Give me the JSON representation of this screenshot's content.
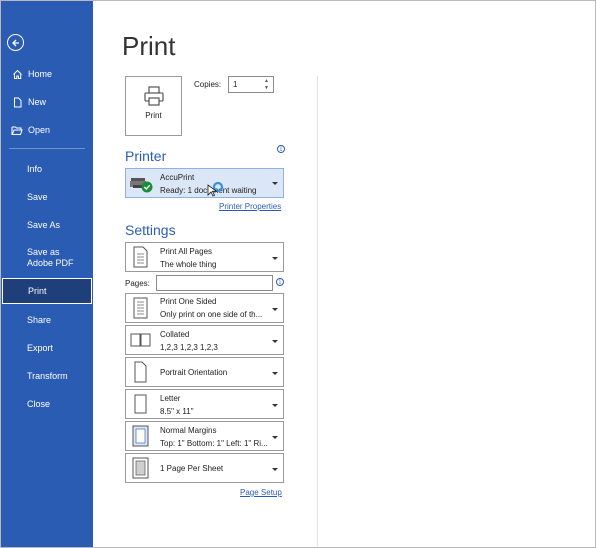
{
  "sidebar": {
    "back_label": "",
    "items": [
      {
        "label": "Home",
        "icon": "home-icon"
      },
      {
        "label": "New",
        "icon": "new-document-icon"
      },
      {
        "label": "Open",
        "icon": "folder-open-icon"
      },
      {
        "label": "Info"
      },
      {
        "label": "Save"
      },
      {
        "label": "Save As"
      },
      {
        "label": "Save as Adobe PDF"
      },
      {
        "label": "Print",
        "active": true
      },
      {
        "label": "Share"
      },
      {
        "label": "Export"
      },
      {
        "label": "Transform"
      },
      {
        "label": "Close"
      }
    ]
  },
  "page": {
    "title": "Print",
    "print_button_label": "Print",
    "copies_label": "Copies:",
    "copies_value": "1"
  },
  "printer": {
    "section_title": "Printer",
    "name": "AccuPrint",
    "status": "Ready: 1 document waiting",
    "properties_link": "Printer Properties"
  },
  "settings": {
    "section_title": "Settings",
    "pages_label": "Pages:",
    "pages_value": "",
    "page_setup_link": "Page Setup",
    "dropdowns": [
      {
        "line1": "Print All Pages",
        "line2": "The whole thing"
      },
      {
        "line1": "Print One Sided",
        "line2": "Only print on one side of th..."
      },
      {
        "line1": "Collated",
        "line2": "1,2,3    1,2,3    1,2,3"
      },
      {
        "line1": "Portrait Orientation",
        "line2": ""
      },
      {
        "line1": "Letter",
        "line2": "8.5\" x 11\""
      },
      {
        "line1": "Normal Margins",
        "line2": "Top: 1\" Bottom: 1\" Left: 1\" Ri..."
      },
      {
        "line1": "1 Page Per Sheet",
        "line2": ""
      }
    ]
  },
  "colors": {
    "sidebar_bg": "#2b5cb4",
    "accent": "#2b5cb4",
    "printer_selected_bg": "#dbe6f6"
  }
}
